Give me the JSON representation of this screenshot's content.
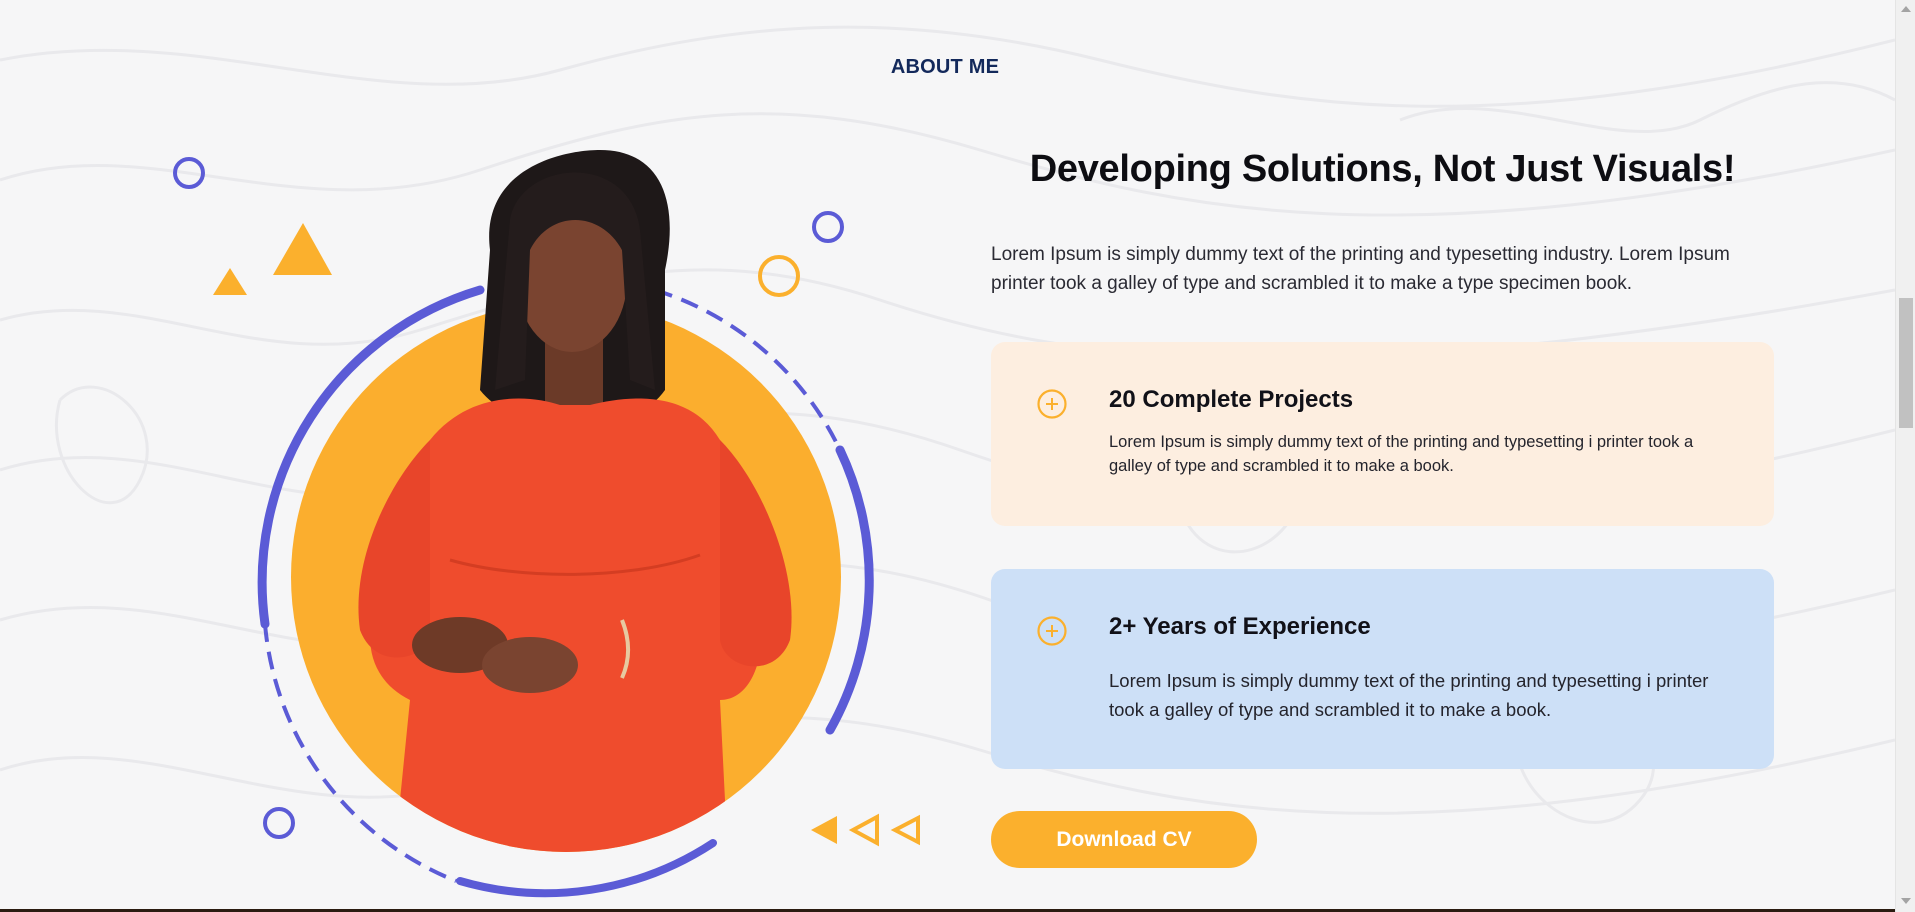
{
  "section": {
    "label": "ABOUT ME"
  },
  "hero": {
    "headline": "Developing Solutions, Not Just Visuals!",
    "intro": "Lorem Ipsum is simply dummy text of the printing and typesetting industry. Lorem Ipsum printer took a galley of type and scrambled it to make a type specimen book."
  },
  "cards": [
    {
      "title": "20 Complete Projects",
      "text": "Lorem Ipsum is simply dummy text of the printing and typesetting i printer took a galley of type and scrambled it to make a book.",
      "icon": "plus-circle-icon",
      "background": "#fdeee0"
    },
    {
      "title": "2+ Years of Experience",
      "text": "Lorem Ipsum is simply dummy text of the printing and typesetting i printer took a galley of type and scrambled it to make a book.",
      "icon": "plus-circle-icon",
      "background": "#cde0f7"
    }
  ],
  "actions": {
    "download_cv": "Download CV"
  },
  "colors": {
    "accent_orange": "#fbb02d",
    "accent_purple": "#5b5bd6",
    "label_navy": "#13295b",
    "dress_red": "#ef4c2d"
  }
}
